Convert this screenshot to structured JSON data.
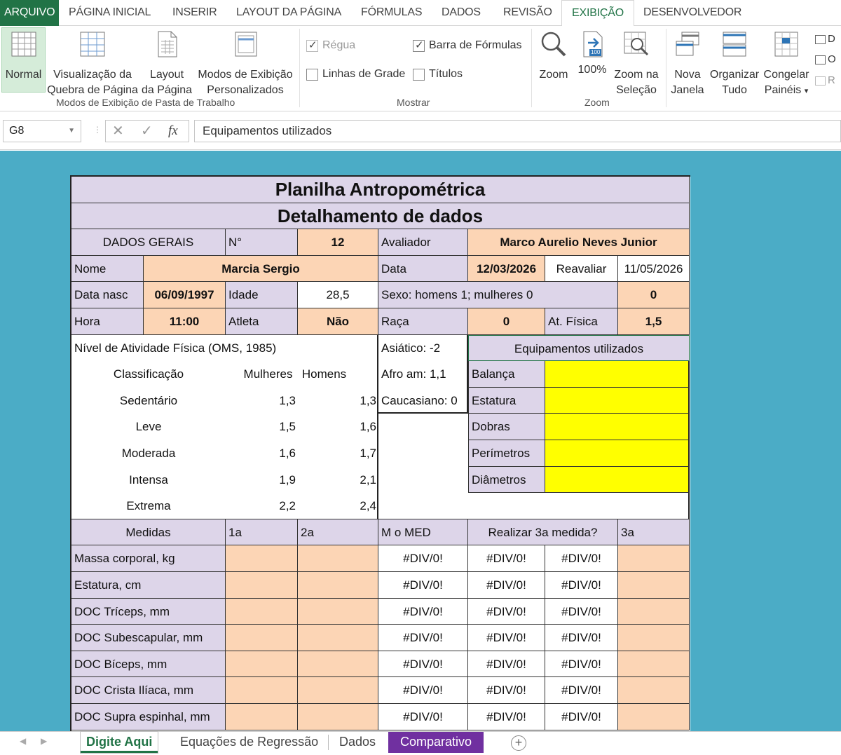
{
  "ribbon": {
    "tabs": [
      "ARQUIVO",
      "PÁGINA INICIAL",
      "INSERIR",
      "LAYOUT DA PÁGINA",
      "FÓRMULAS",
      "DADOS",
      "REVISÃO",
      "EXIBIÇÃO",
      "DESENVOLVEDOR"
    ],
    "active_tab": "EXIBIÇÃO",
    "groups": {
      "workbook_views": {
        "label": "Modos de Exibição de Pasta de Trabalho",
        "normal": "Normal",
        "page_break_1": "Visualização da",
        "page_break_2": "Quebra de Página",
        "page_layout_1": "Layout",
        "page_layout_2": "da Página",
        "custom_1": "Modos de Exibição",
        "custom_2": "Personalizados"
      },
      "show": {
        "label": "Mostrar",
        "ruler": "Régua",
        "formula_bar": "Barra de Fórmulas",
        "gridlines": "Linhas de Grade",
        "headings": "Títulos"
      },
      "zoom": {
        "label": "Zoom",
        "zoom": "Zoom",
        "hundred": "100%",
        "badge": "100",
        "zoom_sel_1": "Zoom na",
        "zoom_sel_2": "Seleção"
      },
      "window": {
        "new_1": "Nova",
        "new_2": "Janela",
        "arrange_1": "Organizar",
        "arrange_2": "Tudo",
        "freeze_1": "Congelar",
        "freeze_2": "Painéis",
        "freeze_caret": "▾",
        "side_1": "D",
        "side_2": "O",
        "side_3": "R"
      }
    }
  },
  "formula_bar": {
    "name_box": "G8",
    "fx": "fx",
    "formula": "Equipamentos utilizados"
  },
  "sheet": {
    "title1": "Planilha Antropométrica",
    "title2": "Detalhamento de dados",
    "dados_gerais": "DADOS GERAIS",
    "n_label": "N°",
    "n_value": "12",
    "avaliador_label": "Avaliador",
    "avaliador_value": "Marco Aurelio Neves Junior",
    "nome_label": "Nome",
    "nome_value": "Marcia Sergio",
    "data_label": "Data",
    "data_value": "12/03/2026",
    "reavaliar_label": "Reavaliar",
    "reavaliar_value": "11/05/2026",
    "datanasc_label": "Data nasc",
    "datanasc_value": "06/09/1997",
    "idade_label": "Idade",
    "idade_value": "28,5",
    "sexo_label": "Sexo: homens 1; mulheres 0",
    "sexo_value": "0",
    "hora_label": "Hora",
    "hora_value": "11:00",
    "atleta_label": "Atleta",
    "atleta_value": "Não",
    "raca_label": "Raça",
    "raca_value": "0",
    "atfisica_label": "At. Física",
    "atfisica_value": "1,5",
    "nivel_title": "Nível de Atividade Física (OMS, 1985)",
    "nivel_headers": [
      "Classificação",
      "Mulheres",
      "Homens"
    ],
    "nivel_rows": [
      {
        "classe": "Sedentário",
        "mulheres": "1,3",
        "homens": "1,3"
      },
      {
        "classe": "Leve",
        "mulheres": "1,5",
        "homens": "1,6"
      },
      {
        "classe": "Moderada",
        "mulheres": "1,6",
        "homens": "1,7"
      },
      {
        "classe": "Intensa",
        "mulheres": "1,9",
        "homens": "2,1"
      },
      {
        "classe": "Extrema",
        "mulheres": "2,2",
        "homens": "2,4"
      }
    ],
    "raca_opts": [
      "Asiático: -2",
      "Afro am: 1,1",
      "Caucasiano: 0"
    ],
    "equip_title": "Equipamentos utilizados",
    "equip_items": [
      "Balança",
      "Estatura",
      "Dobras",
      "Perímetros",
      "Diâmetros"
    ],
    "medidas_headers": [
      "Medidas",
      "1a",
      "2a",
      "M o MED",
      "Realizar 3a medida?",
      "3a"
    ],
    "medidas_rows": [
      {
        "label": "Massa corporal, kg",
        "m": "#DIV/0!",
        "r1": "#DIV/0!",
        "r2": "#DIV/0!"
      },
      {
        "label": "Estatura, cm",
        "m": "#DIV/0!",
        "r1": "#DIV/0!",
        "r2": "#DIV/0!"
      },
      {
        "label": "DOC Tríceps, mm",
        "m": "#DIV/0!",
        "r1": "#DIV/0!",
        "r2": "#DIV/0!"
      },
      {
        "label": "DOC Subescapular, mm",
        "m": "#DIV/0!",
        "r1": "#DIV/0!",
        "r2": "#DIV/0!"
      },
      {
        "label": "DOC Bíceps, mm",
        "m": "#DIV/0!",
        "r1": "#DIV/0!",
        "r2": "#DIV/0!"
      },
      {
        "label": "DOC Crista Ilíaca, mm",
        "m": "#DIV/0!",
        "r1": "#DIV/0!",
        "r2": "#DIV/0!"
      },
      {
        "label": "DOC Supra espinhal, mm",
        "m": "#DIV/0!",
        "r1": "#DIV/0!",
        "r2": "#DIV/0!"
      }
    ]
  },
  "sheet_tabs": {
    "tabs": [
      "Digite Aqui",
      "Equações de Regressão",
      "Dados",
      "Comparativo"
    ],
    "active": "Digite Aqui",
    "add": "+"
  },
  "colors": {
    "excel_green": "#217346",
    "sheet_bg": "#4bacc6",
    "lavender": "#ddd5e9",
    "peach": "#fcd5b5",
    "yellow": "#ffff00",
    "purple_tab": "#7030a0"
  }
}
